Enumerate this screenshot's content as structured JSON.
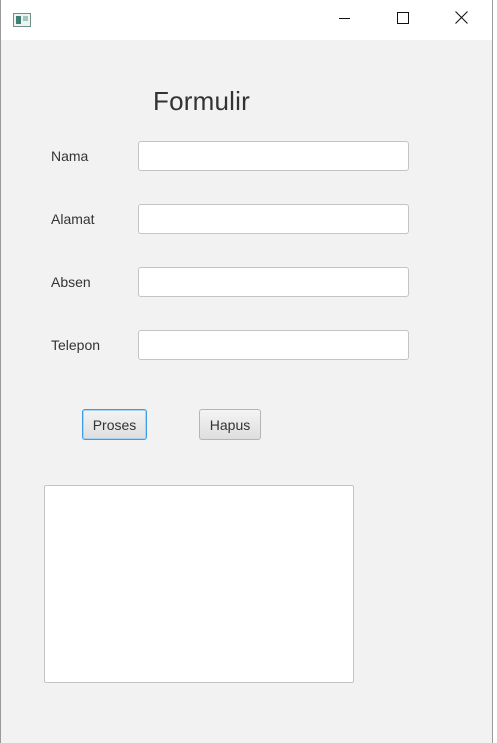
{
  "window": {
    "title": "",
    "icons": {
      "app": "app-icon",
      "minimize": "minimize-icon",
      "maximize": "maximize-icon",
      "close": "close-icon"
    }
  },
  "form": {
    "title": "Formulir",
    "fields": [
      {
        "label": "Nama",
        "value": ""
      },
      {
        "label": "Alamat",
        "value": ""
      },
      {
        "label": "Absen",
        "value": ""
      },
      {
        "label": "Telepon",
        "value": ""
      }
    ],
    "buttons": {
      "proses": "Proses",
      "hapus": "Hapus"
    },
    "output_text": ""
  },
  "colors": {
    "window_bg": "#f2f2f2",
    "focus_accent": "#3d9ce6"
  }
}
